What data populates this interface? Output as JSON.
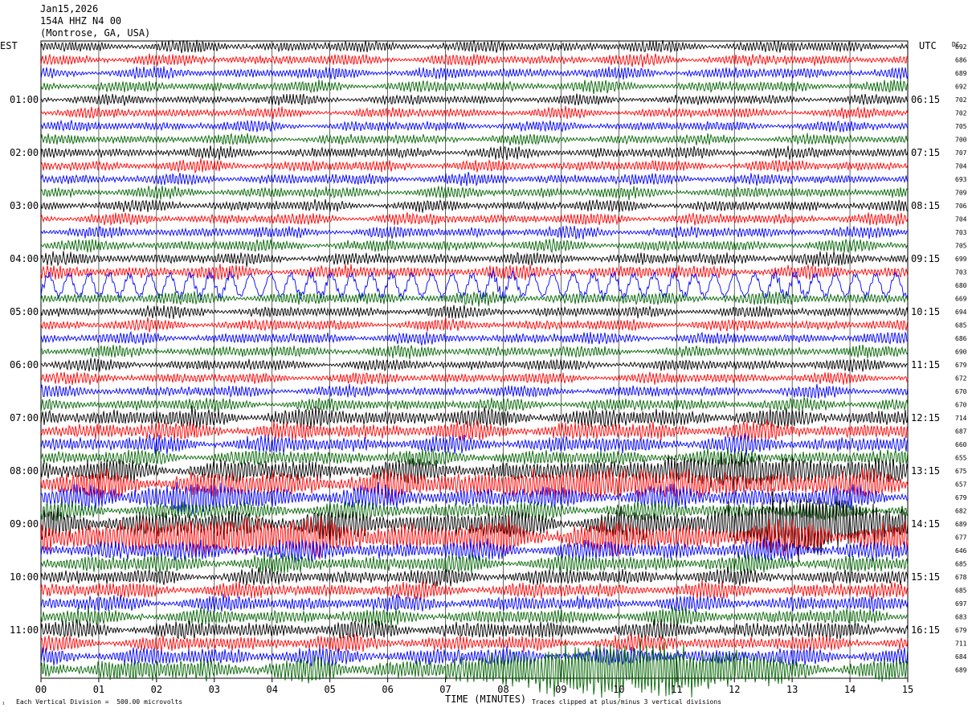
{
  "header": {
    "date": "Jan15,2026",
    "station": "154A HHZ N4 00",
    "location": "(Montrose, GA, USA)"
  },
  "chart_data": {
    "type": "line",
    "left_axis_label": "EST",
    "right_axis_label": "UTC",
    "dc_label": "DC",
    "xlabel": "TIME (MINUTES)",
    "x_ticks": [
      "00",
      "01",
      "02",
      "03",
      "04",
      "05",
      "06",
      "07",
      "08",
      "09",
      "10",
      "11",
      "12",
      "13",
      "14",
      "15"
    ],
    "xlim": [
      0,
      15
    ],
    "trace_colors": [
      "#000000",
      "#ff0000",
      "#0000ff",
      "#006400"
    ],
    "left_hour_labels": [
      "01:00",
      "02:00",
      "03:00",
      "04:00",
      "05:00",
      "06:00",
      "07:00",
      "08:00",
      "09:00",
      "10:00",
      "11:00"
    ],
    "right_hour_labels": [
      "06:15",
      "07:15",
      "08:15",
      "09:15",
      "10:15",
      "11:15",
      "12:15",
      "13:15",
      "14:15",
      "15:15",
      "16:15"
    ],
    "dc_values": [
      "692",
      "686",
      "689",
      "692",
      "702",
      "702",
      "705",
      "700",
      "707",
      "704",
      "693",
      "709",
      "706",
      "704",
      "703",
      "705",
      "699",
      "703",
      "680",
      "669",
      "694",
      "685",
      "686",
      "690",
      "679",
      "672",
      "670",
      "670",
      "714",
      "687",
      "660",
      "655",
      "675",
      "657",
      "679",
      "682",
      "689",
      "677",
      "646",
      "685",
      "678",
      "685",
      "697",
      "683",
      "679",
      "711",
      "684",
      "689"
    ],
    "traces_per_hour": 4,
    "trace_minutes": 15,
    "trace_amplitude_divisions": [
      0.5,
      0.5,
      0.5,
      0.5,
      0.45,
      0.45,
      0.45,
      0.45,
      0.5,
      0.5,
      0.5,
      0.5,
      0.5,
      0.5,
      0.5,
      0.5,
      0.55,
      0.6,
      0.9,
      0.55,
      0.5,
      0.5,
      0.5,
      0.5,
      0.5,
      0.5,
      0.5,
      0.55,
      0.85,
      0.8,
      0.75,
      0.7,
      1.0,
      1.2,
      1.0,
      0.8,
      1.3,
      1.5,
      0.9,
      0.8,
      0.7,
      0.7,
      0.7,
      0.7,
      0.8,
      0.7,
      0.8,
      1.0
    ],
    "events": [
      {
        "trace": 32,
        "start_min": 9.5,
        "end_min": 14.5,
        "amplitude_divisions": 1.8
      },
      {
        "trace": 33,
        "start_min": 5.5,
        "end_min": 14.0,
        "amplitude_divisions": 1.6
      },
      {
        "trace": 34,
        "start_min": 1.5,
        "end_min": 4.0,
        "amplitude_divisions": 1.8
      },
      {
        "trace": 36,
        "start_min": 11.5,
        "end_min": 15.0,
        "amplitude_divisions": 3.5
      },
      {
        "trace": 37,
        "start_min": 0.0,
        "end_min": 6.0,
        "amplitude_divisions": 2.2
      },
      {
        "trace": 47,
        "start_min": 7.0,
        "end_min": 13.0,
        "amplitude_divisions": 3.0
      }
    ],
    "scale_note": "Each Vertical Division =  500.00 microvolts",
    "clip_note": "Traces clipped at plus/minus 3 vertical divisions",
    "corner_mark": "¹"
  }
}
